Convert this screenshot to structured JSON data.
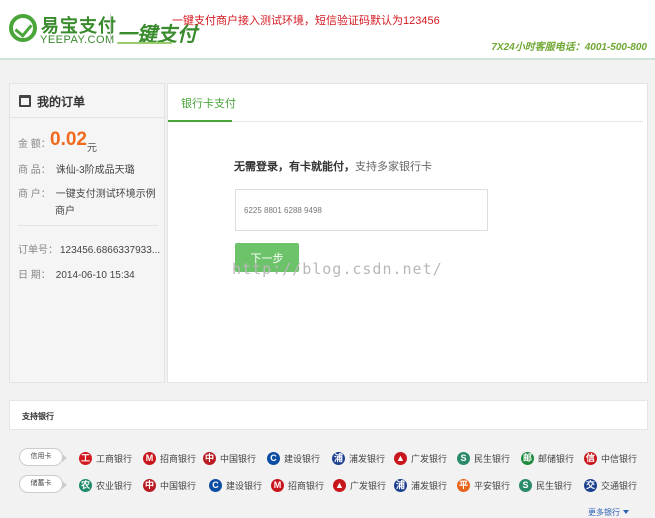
{
  "header": {
    "logo_cn": "易宝支付",
    "logo_en": "YEEPAY.COM",
    "brand2": "一键支付",
    "notice": "一键支付商户接入测试环境，短信验证码默认为123456",
    "hotline": "7X24小时客服电话：4001-500-800"
  },
  "order": {
    "title": "我的订单",
    "amount_label": "金  额：",
    "amount_value": "0.02",
    "amount_unit": "元",
    "product_label": "商  品：",
    "product_value": "诛仙-3阶成品天璐",
    "merchant_label": "商  户：",
    "merchant_value_line1": "一键支付测试环境示例",
    "merchant_value_line2": "商户",
    "order_no_label": "订单号：",
    "order_no_value": "123456.6866337933...",
    "date_label": "日  期：",
    "date_value": "2014-06-10 15:34"
  },
  "pay": {
    "tab_label": "银行卡支付",
    "slogan_bold": "无需登录，有卡就能付，",
    "slogan_rest": "支持多家银行卡",
    "card_placeholder": "6225 8801 6288 9498",
    "next_label": "下一步"
  },
  "watermark": "http://blog.csdn.net/",
  "banks": {
    "title": "支持银行",
    "credit_label": "信用卡",
    "debit_label": "储蓄卡",
    "credit": [
      {
        "name": "工商银行",
        "icon": "icbc-icon",
        "color": "#d4181f",
        "glyph": "工"
      },
      {
        "name": "招商银行",
        "icon": "cmb-icon",
        "color": "#c8161d",
        "glyph": "M"
      },
      {
        "name": "中国银行",
        "icon": "boc-icon",
        "color": "#b81c22",
        "glyph": "中"
      },
      {
        "name": "建设银行",
        "icon": "ccb-icon",
        "color": "#0a4da2",
        "glyph": "C"
      },
      {
        "name": "浦发银行",
        "icon": "spdb-icon",
        "color": "#1c3f8f",
        "glyph": "浦"
      },
      {
        "name": "广发银行",
        "icon": "cgb-icon",
        "color": "#c8161d",
        "glyph": "▲"
      },
      {
        "name": "民生银行",
        "icon": "cmbc-icon",
        "color": "#2a8a6a",
        "glyph": "S"
      },
      {
        "name": "邮储银行",
        "icon": "psbc-icon",
        "color": "#1d8a3c",
        "glyph": "邮"
      },
      {
        "name": "中信银行",
        "icon": "citic-icon",
        "color": "#c8161d",
        "glyph": "信"
      }
    ],
    "debit": [
      {
        "name": "农业银行",
        "icon": "abc-icon",
        "color": "#1d8a6a",
        "glyph": "农"
      },
      {
        "name": "中国银行",
        "icon": "boc-icon",
        "color": "#b81c22",
        "glyph": "中"
      },
      {
        "name": "建设银行",
        "icon": "ccb-icon",
        "color": "#0a4da2",
        "glyph": "C"
      },
      {
        "name": "招商银行",
        "icon": "cmb-icon",
        "color": "#c8161d",
        "glyph": "M"
      },
      {
        "name": "广发银行",
        "icon": "cgb-icon",
        "color": "#c8161d",
        "glyph": "▲"
      },
      {
        "name": "浦发银行",
        "icon": "spdb-icon",
        "color": "#1c3f8f",
        "glyph": "浦"
      },
      {
        "name": "平安银行",
        "icon": "pingan-icon",
        "color": "#e8631c",
        "glyph": "平"
      },
      {
        "name": "民生银行",
        "icon": "cmbc-icon",
        "color": "#2a8a6a",
        "glyph": "S"
      },
      {
        "name": "交通银行",
        "icon": "bocom-icon",
        "color": "#1c3f8f",
        "glyph": "交"
      }
    ],
    "more_label": "更多银行"
  },
  "colors": {
    "brand_green": "#4aa53b",
    "amount_orange": "#f06a1c",
    "notice_red": "#d4181f",
    "button_green": "#6cc36a",
    "link_blue": "#2a62b5"
  }
}
